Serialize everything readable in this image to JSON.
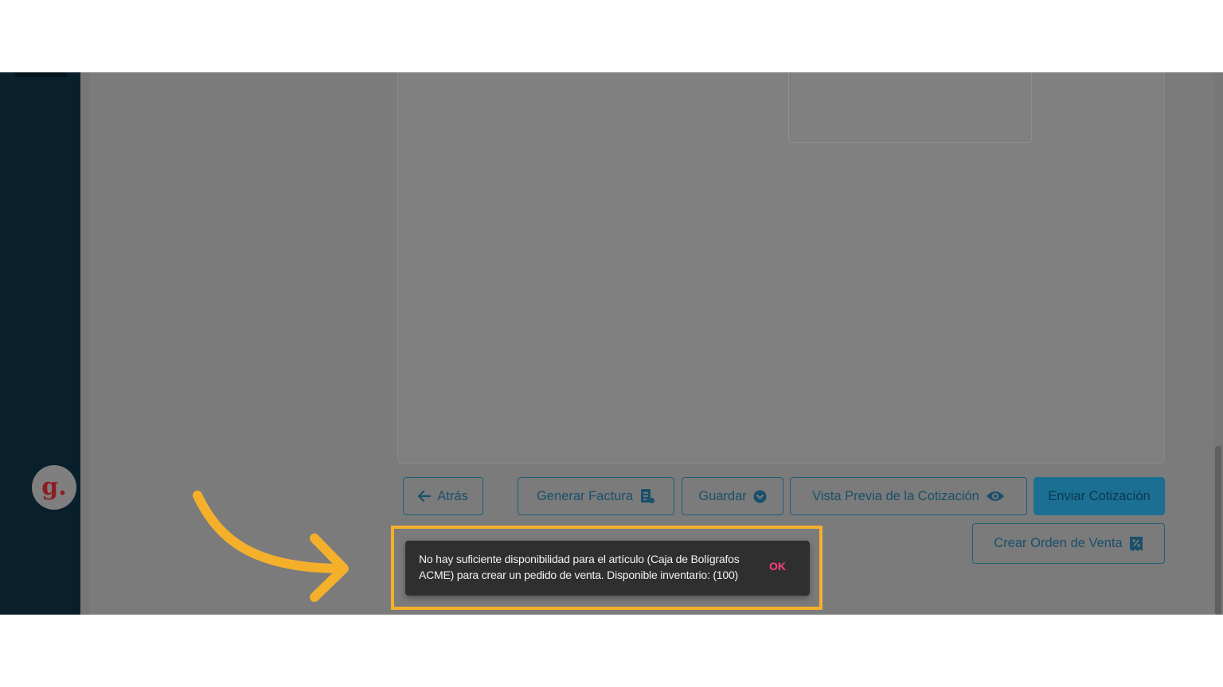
{
  "buttons": {
    "back": "Atrás",
    "generate_invoice": "Generar Factura",
    "save": "Guardar",
    "preview_quote": "Vista Previa de la Cotización",
    "send_quote": "Enviar Cotización",
    "create_sales_order": "Crear Orden de Venta"
  },
  "toast": {
    "message": "No hay suficiente disponibilidad para el artículo (Caja de Bolígrafos ACME) para crear un pedido de venta. Disponible inventario: (100)",
    "action": "OK"
  },
  "avatar": {
    "letter": "g."
  },
  "icons": {
    "back": "arrow-left-icon",
    "invoice": "invoice-icon",
    "save_dropdown": "chevron-down-circle-icon",
    "preview": "eye-icon",
    "sales_order": "receipt-percent-icon"
  },
  "colors": {
    "accent": "#1b6f93",
    "highlight": "#f5b02b",
    "toast_action": "#ff4081",
    "sidebar": "#0a1f2c",
    "avatar_text": "#8e1b22"
  }
}
